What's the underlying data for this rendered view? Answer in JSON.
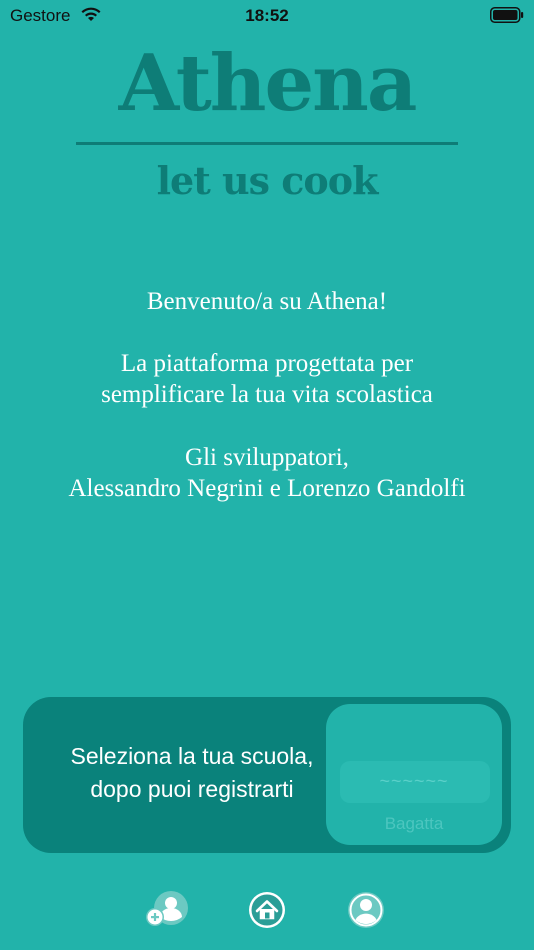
{
  "status_bar": {
    "carrier": "Gestore",
    "time": "18:52"
  },
  "brand": {
    "title": "Athena",
    "tagline": "let us cook"
  },
  "welcome": {
    "greeting": "Benvenuto/a su Athena!",
    "description_line1": "La piattaforma progettata per",
    "description_line2": "semplificare la tua vita scolastica",
    "signature_line1": "Gli sviluppatori,",
    "signature_line2": "Alessandro Negrini e Lorenzo Gandolfi"
  },
  "school_picker": {
    "prompt_line1": "Seleziona la tua scuola,",
    "prompt_line2": "dopo puoi registrarti",
    "selected_value": "~~~~~~",
    "next_option": "Bagatta"
  },
  "tab_bar": {
    "icons": [
      "add-user-icon",
      "home-icon",
      "profile-icon"
    ],
    "active": "home-icon"
  },
  "colors": {
    "background": "#22b3aa",
    "accent_dark": "#0e7d77",
    "card": "#0a827b"
  }
}
